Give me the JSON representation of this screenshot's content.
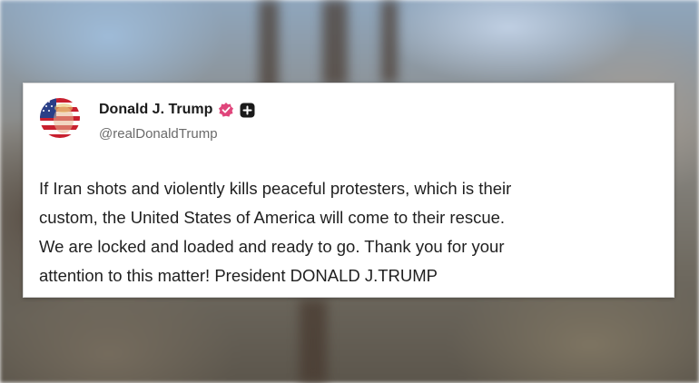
{
  "post": {
    "author": {
      "display_name": "Donald J. Trump",
      "handle": "@realDonaldTrump",
      "avatar_icon": "flag-portrait-avatar",
      "verified_icon": "verified-badge-icon",
      "verified_color": "#e0457b",
      "plus_icon": "plus-badge-icon"
    },
    "text_lines": [
      "If Iran shots and violently kills peaceful protesters, which is their",
      "custom, the United States of America will come to their rescue.",
      "We are locked and loaded and ready to go. Thank you for your",
      "attention to this matter! President DONALD J.TRUMP"
    ]
  }
}
